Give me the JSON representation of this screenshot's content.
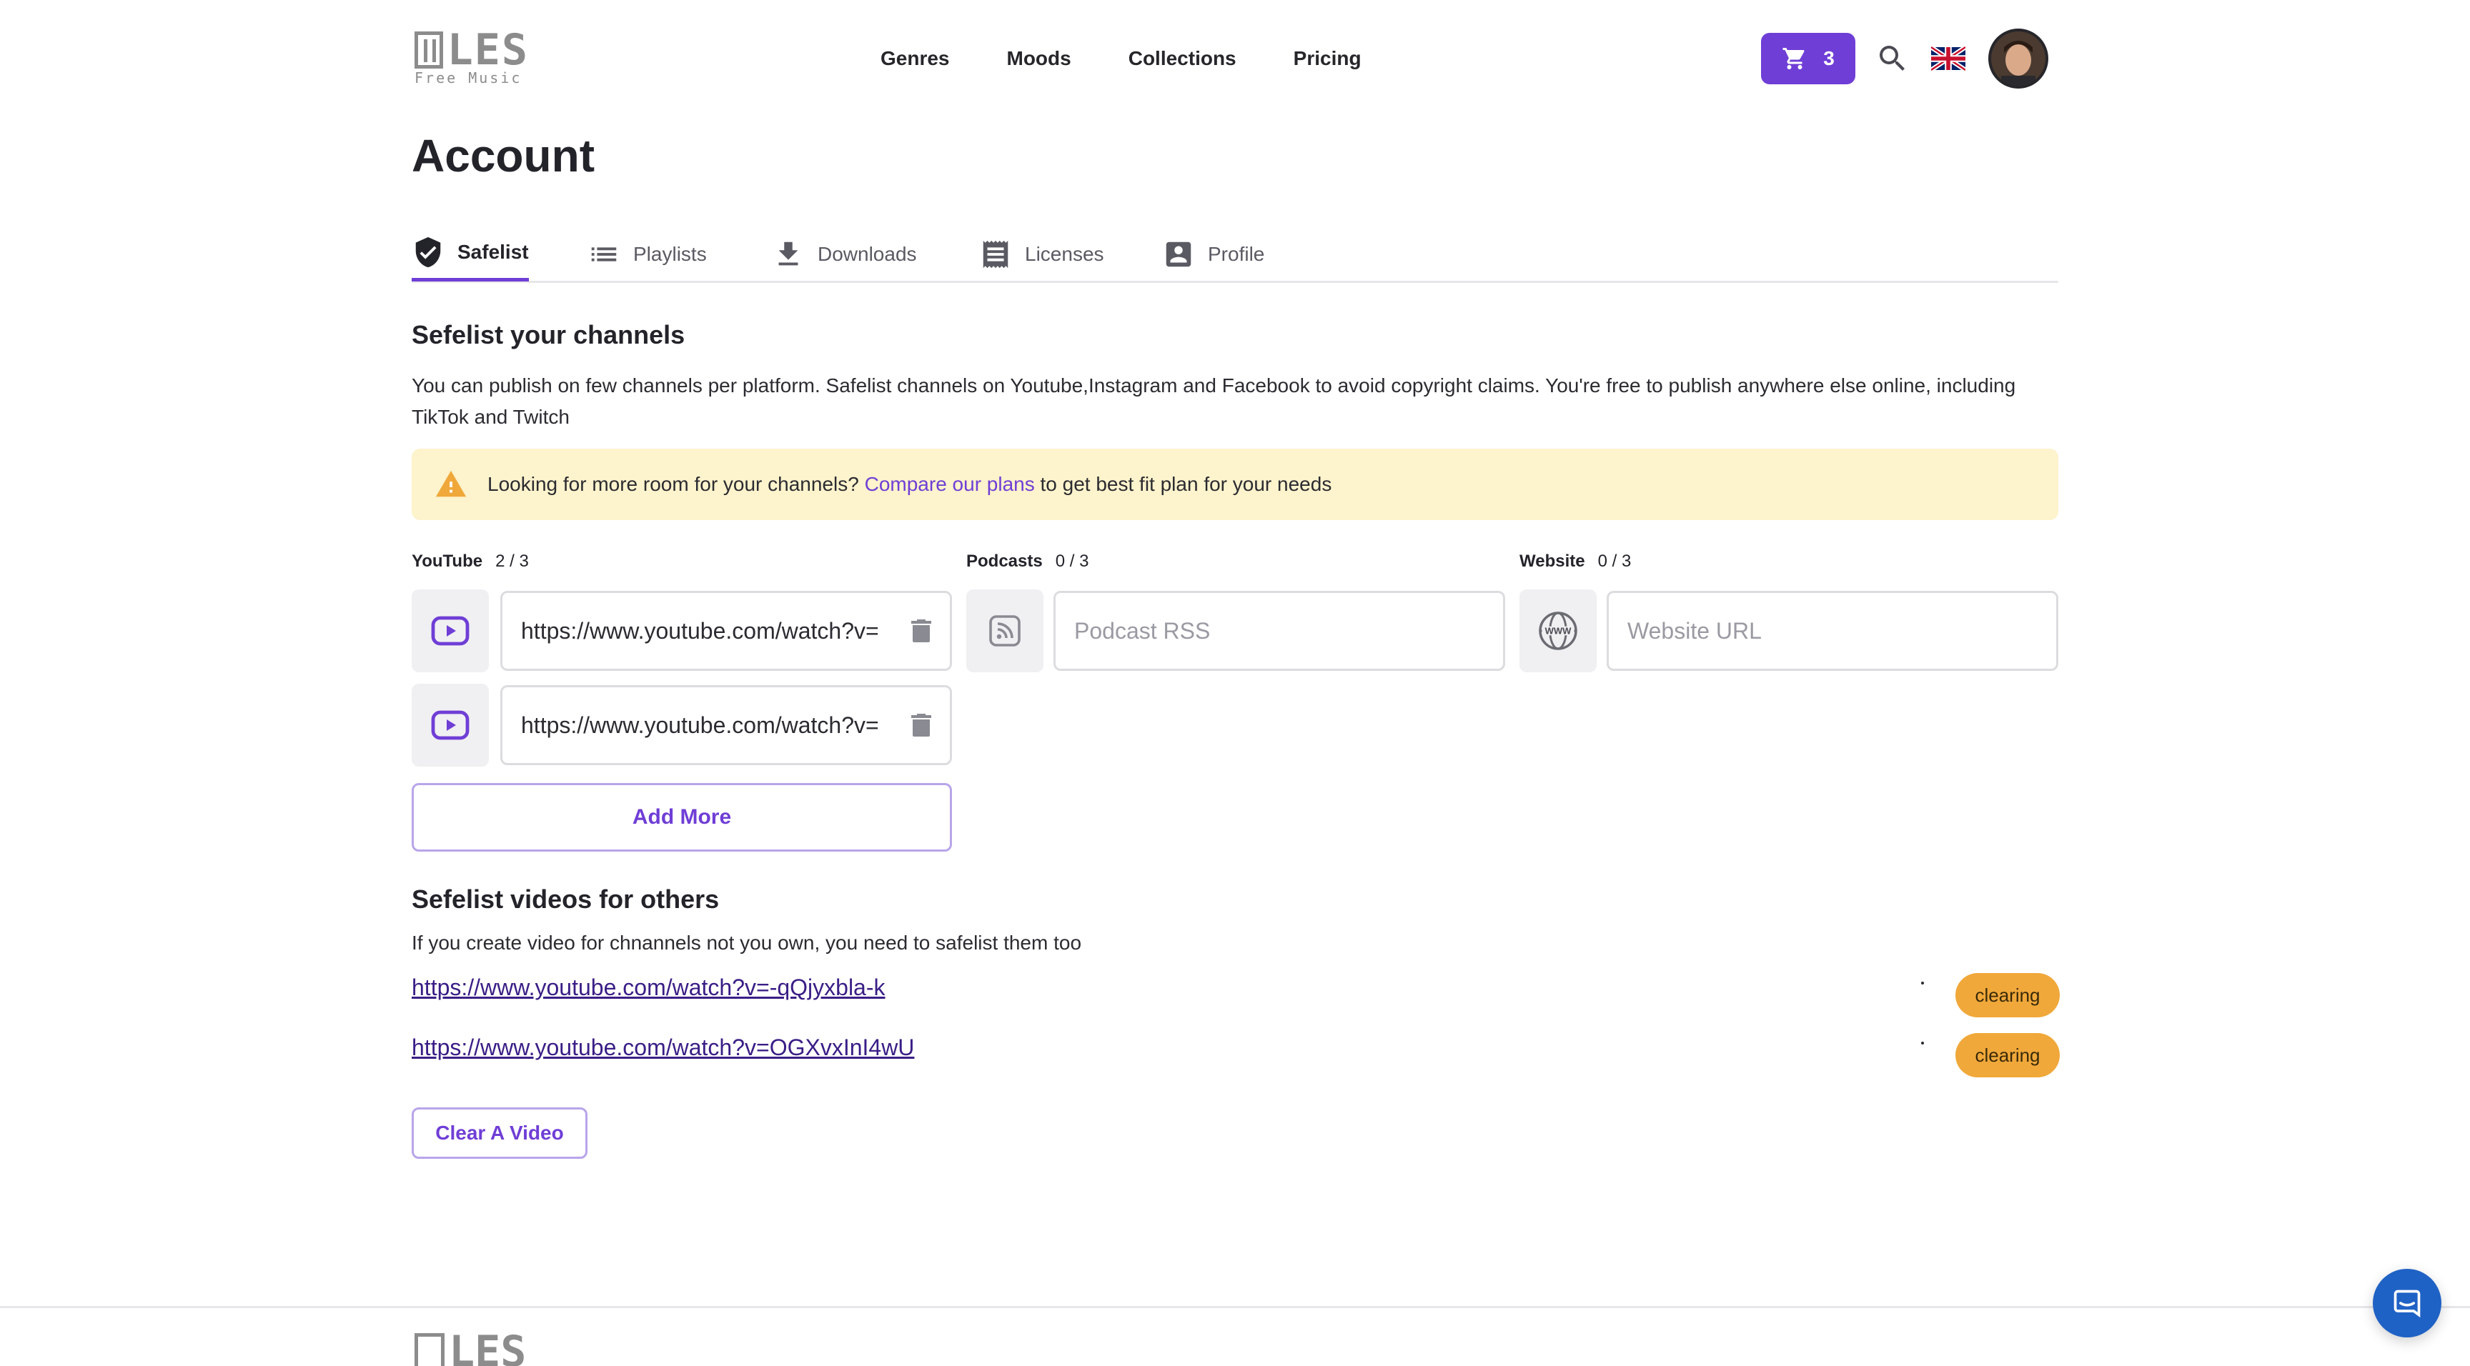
{
  "header": {
    "logo": {
      "mark_text": "LES",
      "sub_text": "Free Music"
    },
    "nav": [
      "Genres",
      "Moods",
      "Collections",
      "Pricing"
    ],
    "cart_count": "3",
    "flag": "uk-flag-icon",
    "colors": {
      "accent": "#6f3ed6"
    }
  },
  "page": {
    "title": "Account"
  },
  "tabs": [
    {
      "label": "Safelist",
      "icon": "shield-check-icon",
      "active": true
    },
    {
      "label": "Playlists",
      "icon": "list-icon",
      "active": false
    },
    {
      "label": "Downloads",
      "icon": "download-icon",
      "active": false
    },
    {
      "label": "Licenses",
      "icon": "receipt-icon",
      "active": false
    },
    {
      "label": "Profile",
      "icon": "profile-card-icon",
      "active": false
    }
  ],
  "channels": {
    "heading": "Sefelist your channels",
    "description": "You can publish on few channels per platform. Safelist channels on Youtube,Instagram and Facebook to avoid copyright claims. You're free to publish anywhere else online, including TikTok and Twitch",
    "alert": {
      "text_before": "Looking for more room for your channels?",
      "link": "Compare our plans",
      "text_after": "to get best fit plan for your needs"
    },
    "youtube": {
      "label": "YouTube",
      "count": "2 / 3",
      "values": [
        "https://www.youtube.com/watch?v=",
        "https://www.youtube.com/watch?v="
      ]
    },
    "podcasts": {
      "label": "Podcasts",
      "count": "0 / 3",
      "placeholder": "Podcast RSS"
    },
    "website": {
      "label": "Website",
      "count": "0 / 3",
      "placeholder": "Website URL"
    },
    "add_more": "Add More"
  },
  "others": {
    "heading": "Sefelist videos for others",
    "description": "If you create video for chnannels not you own, you need to safelist them too",
    "videos": [
      {
        "url": "https://www.youtube.com/watch?v=-qQjyxbla-k",
        "status": "clearing"
      },
      {
        "url": "https://www.youtube.com/watch?v=OGXvxInI4wU",
        "status": "clearing"
      }
    ],
    "clear_button": "Clear A Video"
  }
}
